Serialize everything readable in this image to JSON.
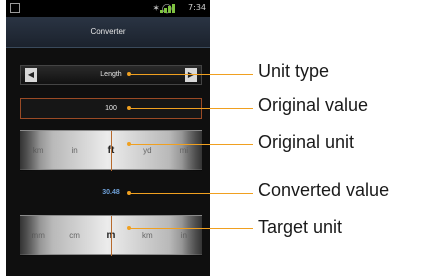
{
  "status_bar": {
    "time": "7:34"
  },
  "app": {
    "title": "Converter"
  },
  "unit_type": {
    "value": "Length"
  },
  "input": {
    "value": "100"
  },
  "original_units": [
    "km",
    "in",
    "ft",
    "yd",
    "mi"
  ],
  "original_selected": "ft",
  "converted": {
    "value": "30.48"
  },
  "target_units": [
    "mm",
    "cm",
    "m",
    "km",
    "in"
  ],
  "target_selected": "m",
  "callouts": {
    "unit_type": "Unit type",
    "original_value": "Original value",
    "original_unit": "Original unit",
    "converted_value": "Converted value",
    "target_unit": "Target unit"
  },
  "colors": {
    "callout_line": "#f0a020",
    "converted_text": "#6ea0d8",
    "input_border": "#9a4a25"
  }
}
